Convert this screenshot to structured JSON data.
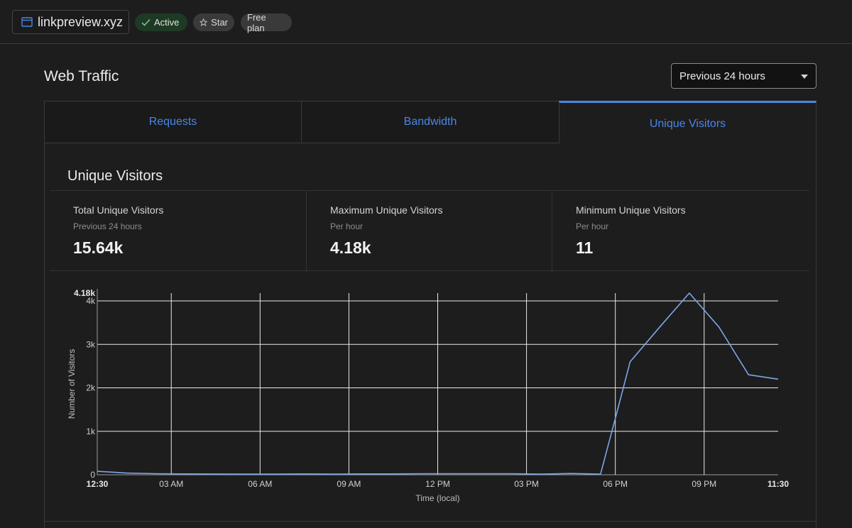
{
  "header": {
    "domain": "linkpreview.xyz",
    "status_label": "Active",
    "star_label": "Star",
    "plan_label": "Free plan"
  },
  "page": {
    "title": "Web Traffic",
    "range_selected": "Previous 24 hours"
  },
  "tabs": [
    {
      "label": "Requests"
    },
    {
      "label": "Bandwidth"
    },
    {
      "label": "Unique Visitors"
    }
  ],
  "section": {
    "title": "Unique Visitors",
    "stats": [
      {
        "label": "Total Unique Visitors",
        "sub": "Previous 24 hours",
        "value": "15.64k"
      },
      {
        "label": "Maximum Unique Visitors",
        "sub": "Per hour",
        "value": "4.18k"
      },
      {
        "label": "Minimum Unique Visitors",
        "sub": "Per hour",
        "value": "11"
      }
    ]
  },
  "colors": {
    "accent": "#4a86e8",
    "line": "#7aa7e8"
  },
  "chart_data": {
    "type": "line",
    "xlabel": "Time (local)",
    "ylabel": "Number of Visitors",
    "ylim": [
      0,
      4180
    ],
    "x_range_hours": [
      0.5,
      23.5
    ],
    "x_ticks": [
      {
        "label": "12:30",
        "hour": 0.5,
        "bold": true
      },
      {
        "label": "03 AM",
        "hour": 3
      },
      {
        "label": "06 AM",
        "hour": 6
      },
      {
        "label": "09 AM",
        "hour": 9
      },
      {
        "label": "12 PM",
        "hour": 12
      },
      {
        "label": "03 PM",
        "hour": 15
      },
      {
        "label": "06 PM",
        "hour": 18
      },
      {
        "label": "09 PM",
        "hour": 21
      },
      {
        "label": "11:30",
        "hour": 23.5,
        "bold": true
      }
    ],
    "y_ticks": [
      {
        "label": "0",
        "value": 0
      },
      {
        "label": "1k",
        "value": 1000
      },
      {
        "label": "2k",
        "value": 2000
      },
      {
        "label": "3k",
        "value": 3000
      },
      {
        "label": "4k",
        "value": 4000
      },
      {
        "label": "4.18k",
        "value": 4180,
        "bold": true
      }
    ],
    "series": [
      {
        "x": [
          0.5,
          1.5,
          2.5,
          3.5,
          4.5,
          5.5,
          6.5,
          7.5,
          8.5,
          9.5,
          10.5,
          11.5,
          12.5,
          13.5,
          14.5,
          15.5,
          16.5,
          17.5,
          18,
          18.5,
          19.5,
          20.5,
          21.5,
          22.5,
          23.5
        ],
        "values": [
          80,
          40,
          25,
          20,
          18,
          15,
          15,
          20,
          15,
          20,
          20,
          25,
          25,
          25,
          25,
          15,
          30,
          15,
          1300,
          2600,
          3400,
          4180,
          3400,
          2300,
          2200
        ]
      }
    ]
  }
}
